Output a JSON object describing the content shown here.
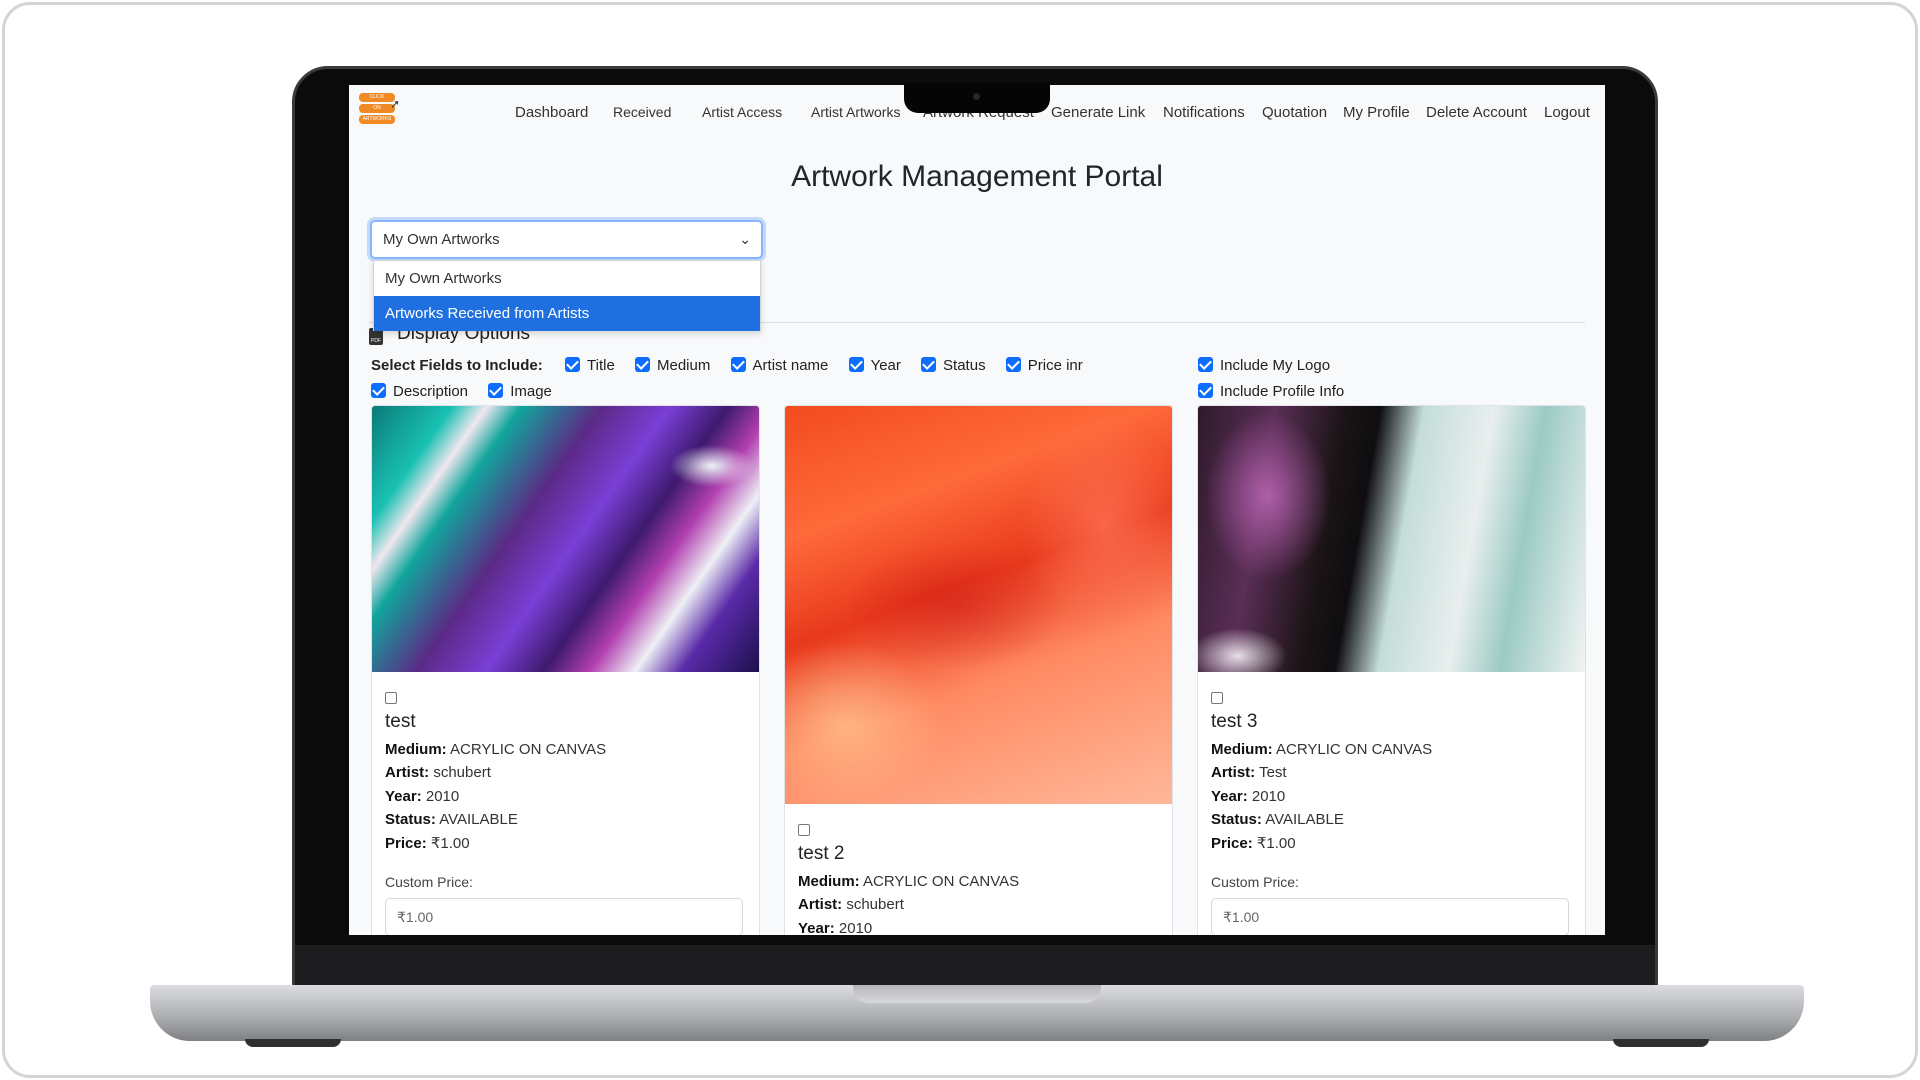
{
  "nav": {
    "items": [
      "Dashboard",
      "Received",
      "Artist Access",
      "Artist Artworks",
      "Artwork Request",
      "Generate Link",
      "Notifications",
      "Quotation",
      "My Profile",
      "Delete Account",
      "Logout"
    ]
  },
  "page": {
    "title": "Artwork Management Portal"
  },
  "select": {
    "value": "My Own Artworks",
    "options": [
      "My Own Artworks",
      "Artworks Received from Artists"
    ],
    "highlighted": "Artworks Received from Artists"
  },
  "display_options": {
    "heading": "Display Options",
    "fields_label": "Select Fields to Include:",
    "fields": [
      "Title",
      "Medium",
      "Artist name",
      "Year",
      "Status",
      "Price inr",
      "Description",
      "Image"
    ],
    "extras": [
      "Include My Logo",
      "Include Profile Info"
    ]
  },
  "labels": {
    "medium": "Medium:",
    "artist": "Artist:",
    "year": "Year:",
    "status": "Status:",
    "price": "Price:",
    "custom_price": "Custom Price:"
  },
  "cards": [
    {
      "title": "test",
      "medium": "ACRYLIC ON CANVAS",
      "artist": "schubert",
      "year": "2010",
      "status": "AVAILABLE",
      "price": "₹1.00",
      "custom_price": "₹1.00"
    },
    {
      "title": "test 2",
      "medium": "ACRYLIC ON CANVAS",
      "artist": "schubert",
      "year": "2010"
    },
    {
      "title": "test 3",
      "medium": "ACRYLIC ON CANVAS",
      "artist": "Test",
      "year": "2010",
      "status": "AVAILABLE",
      "price": "₹1.00",
      "custom_price": "₹1.00"
    }
  ],
  "colors": {
    "accent": "#0d6efd",
    "highlight": "#1f6fe0",
    "brand": "#f08a24"
  }
}
